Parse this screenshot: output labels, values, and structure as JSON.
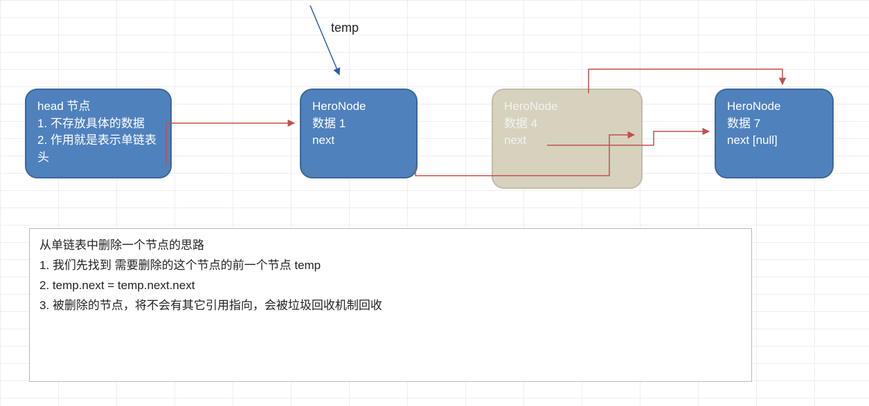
{
  "temp_label": "temp",
  "head_node": {
    "title": "head 节点",
    "line1": "1. 不存放具体的数据",
    "line2": "2. 作用就是表示单链表头"
  },
  "node1": {
    "title": "HeroNode",
    "data": "数据 1",
    "next": "next"
  },
  "node4": {
    "title": "HeroNode",
    "data": "数据 4",
    "next": "next"
  },
  "node7": {
    "title": "HeroNode",
    "data": "数据 7",
    "next": "next [null]"
  },
  "explain": {
    "title": "从单链表中删除一个节点的思路",
    "s1": "1.  我们先找到 需要删除的这个节点的前一个节点 temp",
    "s2": "2.   temp.next = temp.next.next",
    "s3": "3. 被删除的节点，将不会有其它引用指向，会被垃圾回收机制回收"
  },
  "colors": {
    "node_fill": "#4f81bd",
    "node_border": "#3b6797",
    "faded_fill": "#d7d2be",
    "arrow_red": "#c0504d",
    "arrow_blue": "#2a5db0"
  }
}
